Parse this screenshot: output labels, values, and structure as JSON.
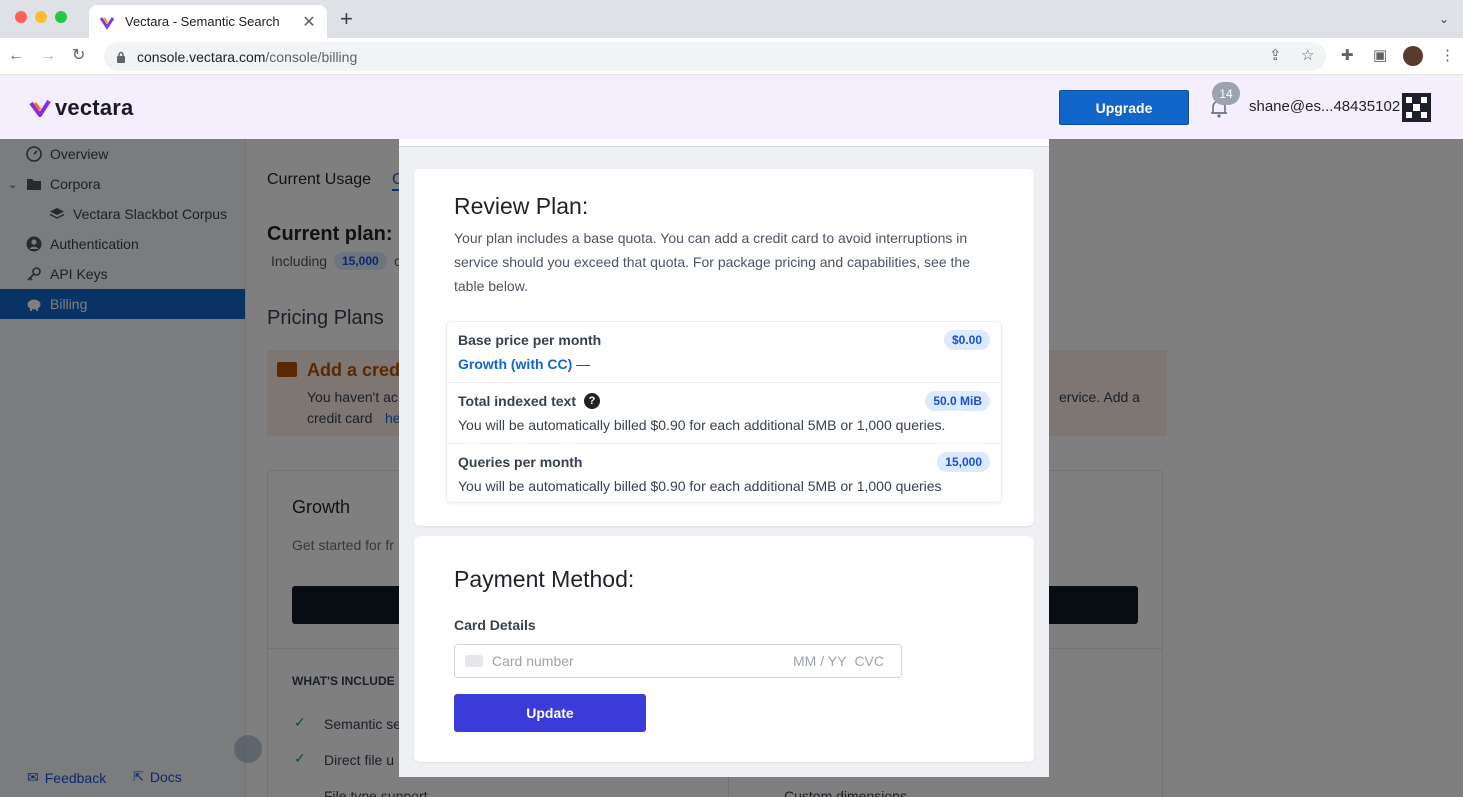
{
  "browser": {
    "tab_title": "Vectara - Semantic Search",
    "url_host": "console.vectara.com",
    "url_path": "/console/billing"
  },
  "header": {
    "logo_text": "vectara",
    "upgrade_label": "Upgrade",
    "notification_count": "14",
    "user_email": "shane@es...48435102"
  },
  "sidebar": {
    "items": [
      {
        "label": "Overview",
        "icon": "gauge-icon"
      },
      {
        "label": "Corpora",
        "icon": "folder-icon"
      },
      {
        "label": "Vectara Slackbot Corpus",
        "icon": "layers-icon"
      },
      {
        "label": "Authentication",
        "icon": "user-circle-icon"
      },
      {
        "label": "API Keys",
        "icon": "key-icon"
      },
      {
        "label": "Billing",
        "icon": "piggy-bank-icon"
      }
    ],
    "feedback_label": "Feedback",
    "docs_label": "Docs"
  },
  "background": {
    "tab_current_usage": "Current Usage",
    "tab_other": "C",
    "current_plan": "Current plan: C",
    "including": "Including",
    "including_pill": "15,000",
    "including_rest": "c",
    "pricing_plans": "Pricing Plans",
    "warn_title": "Add a credi",
    "warn_text_1": "You haven't ac",
    "warn_text_1_right": "ervice. Add a",
    "warn_text_2": "credit card",
    "warn_link": "he",
    "growth_title": "Growth",
    "growth_desc": "Get started for fr",
    "whats_included": "WHAT'S INCLUDE",
    "features": [
      "Semantic se",
      "Direct file u",
      "File type support"
    ],
    "right_feature": "Custom dimensions"
  },
  "modal": {
    "review_title": "Review Plan:",
    "review_desc": "Your plan includes a base quota. You can add a credit card to avoid interruptions in service should you exceed that quota. For package pricing and capabilities, see the table below.",
    "rows": [
      {
        "label": "Base price per month",
        "sub_link": "Growth (with CC)",
        "sub_rest": " —",
        "pill": "$0.00"
      },
      {
        "label": "Total indexed text",
        "sub": "You will be automatically billed $0.90 for each additional 5MB or 1,000 queries.",
        "pill": "50.0 MiB",
        "help": "?"
      },
      {
        "label": "Queries per month",
        "sub": "You will be automatically billed $0.90 for each additional 5MB or 1,000 queries",
        "pill": "15,000"
      }
    ],
    "payment_title": "Payment Method:",
    "card_details_label": "Card Details",
    "card_placeholder": "Card number",
    "card_expiry": "MM / YY",
    "card_cvc": "CVC",
    "update_label": "Update"
  },
  "colors": {
    "accent": "#1366c9",
    "update_button": "#3b3bd9",
    "pill_bg": "#dbeafe",
    "header_bg": "#f5effd"
  }
}
